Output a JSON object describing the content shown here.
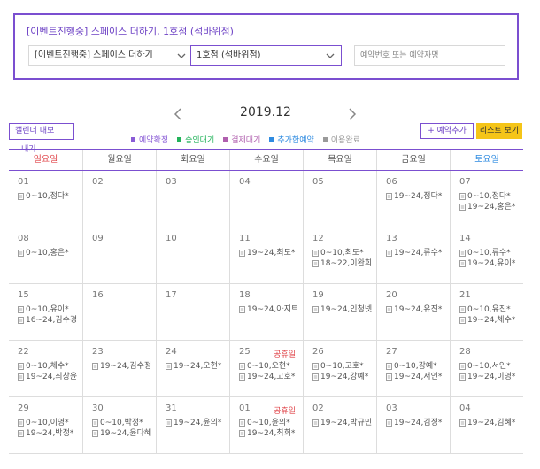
{
  "filter": {
    "title": "[이벤트진행중] 스페이스 더하기, 1호점 (석바위점)",
    "space_select": "[이벤트진행중] 스페이스 더하기",
    "branch_select": "1호점 (석바위점)",
    "search_placeholder": "예약번호 또는 예약자명"
  },
  "toolbar": {
    "month": "2019.12",
    "calendar_export_label": "캘린더 내보",
    "calendar_export_wrap": "내기",
    "add_reservation_label": "+ 예약추가",
    "list_view_label": "리스트 보기"
  },
  "legend": [
    {
      "label": "예약확정",
      "color": "#8a5cd6"
    },
    {
      "label": "승인대기",
      "color": "#22b35a"
    },
    {
      "label": "결제대기",
      "color": "#b05fae"
    },
    {
      "label": "추가한예약",
      "color": "#2f8be0"
    },
    {
      "label": "이용완료",
      "color": "#9a9a9a"
    }
  ],
  "weekdays": [
    "일요일",
    "월요일",
    "화요일",
    "수요일",
    "목요일",
    "금요일",
    "토요일"
  ],
  "weeks": [
    [
      {
        "day": "01",
        "entries": [
          "0~10,정다*"
        ]
      },
      {
        "day": "02",
        "entries": []
      },
      {
        "day": "03",
        "entries": []
      },
      {
        "day": "04",
        "entries": []
      },
      {
        "day": "05",
        "entries": []
      },
      {
        "day": "06",
        "entries": [
          "19~24,정다*"
        ]
      },
      {
        "day": "07",
        "entries": [
          "0~10,정다*",
          "19~24,홍은*"
        ]
      }
    ],
    [
      {
        "day": "08",
        "entries": [
          "0~10,홍은*"
        ]
      },
      {
        "day": "09",
        "entries": []
      },
      {
        "day": "10",
        "entries": []
      },
      {
        "day": "11",
        "entries": [
          "19~24,최도*"
        ]
      },
      {
        "day": "12",
        "entries": [
          "0~10,최도*",
          "18~22,이완희"
        ]
      },
      {
        "day": "13",
        "entries": [
          "19~24,류수*"
        ]
      },
      {
        "day": "14",
        "entries": [
          "0~10,류수*",
          "19~24,유이*"
        ]
      }
    ],
    [
      {
        "day": "15",
        "entries": [
          "0~10,유이*",
          "16~24,김수경"
        ]
      },
      {
        "day": "16",
        "entries": []
      },
      {
        "day": "17",
        "entries": []
      },
      {
        "day": "18",
        "entries": [
          "19~24,아지트"
        ]
      },
      {
        "day": "19",
        "entries": [
          "19~24,인청넷"
        ]
      },
      {
        "day": "20",
        "entries": [
          "19~24,유진*"
        ]
      },
      {
        "day": "21",
        "entries": [
          "0~10,유진*",
          "19~24,체수*"
        ]
      }
    ],
    [
      {
        "day": "22",
        "entries": [
          "0~10,체수*",
          "19~24,최창윤"
        ]
      },
      {
        "day": "23",
        "entries": [
          "19~24,김수정"
        ]
      },
      {
        "day": "24",
        "entries": [
          "19~24,오현*"
        ]
      },
      {
        "day": "25",
        "holiday": "공휴일",
        "entries": [
          "0~10,오현*",
          "19~24,고호*"
        ]
      },
      {
        "day": "26",
        "entries": [
          "0~10,고호*",
          "19~24,강예*"
        ]
      },
      {
        "day": "27",
        "entries": [
          "0~10,강예*",
          "19~24,서인*"
        ]
      },
      {
        "day": "28",
        "entries": [
          "0~10,서인*",
          "19~24,이영*"
        ]
      }
    ],
    [
      {
        "day": "29",
        "entries": [
          "0~10,이영*",
          "19~24,박정*"
        ]
      },
      {
        "day": "30",
        "entries": [
          "0~10,박정*",
          "19~24,윤다혜"
        ]
      },
      {
        "day": "31",
        "entries": [
          "19~24,윤의*"
        ]
      },
      {
        "day": "01",
        "holiday": "공휴일",
        "entries": [
          "0~10,윤의*",
          "19~24,최희*"
        ]
      },
      {
        "day": "02",
        "entries": [
          "19~24,박규민"
        ]
      },
      {
        "day": "03",
        "entries": [
          "19~24,김정*"
        ]
      },
      {
        "day": "04",
        "entries": [
          "19~24,김혜*"
        ]
      }
    ]
  ]
}
